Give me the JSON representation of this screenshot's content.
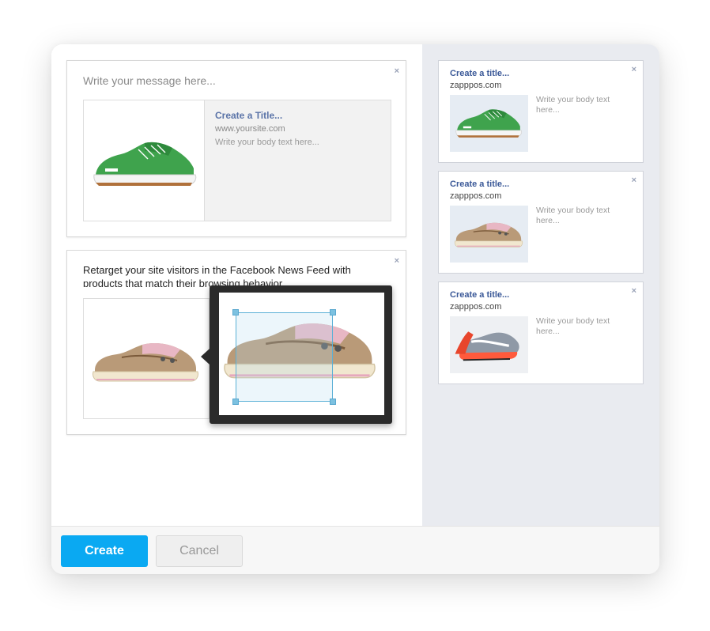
{
  "composer": {
    "message_placeholder": "Write your message here...",
    "preview": {
      "title": "Create a Title...",
      "url": "www.yoursite.com",
      "body": "Write your body text here..."
    },
    "close_glyph": "×"
  },
  "retarget": {
    "description": "Retarget your site visitors in the Facebook News Feed with products that match their browsing behavior.",
    "close_glyph": "×",
    "product_icon": "boat-shoe-image"
  },
  "ads": [
    {
      "title": "Create a title...",
      "site": "zapppos.com",
      "body": "Write your body text here...",
      "image": "green-sneaker-image",
      "close_glyph": "×"
    },
    {
      "title": "Create a title...",
      "site": "zapppos.com",
      "body": "Write your body text here...",
      "image": "boat-shoe-image",
      "close_glyph": "×"
    },
    {
      "title": "Create a title...",
      "site": "zapppos.com",
      "body": "Write your body text here...",
      "image": "running-shoe-image",
      "close_glyph": "×"
    }
  ],
  "footer": {
    "create_label": "Create",
    "cancel_label": "Cancel"
  },
  "colors": {
    "primary_button": "#0aa9f2",
    "link_title": "#3b5998",
    "crop_border": "#5bb0d6",
    "side_panel_bg": "#e9ebf0"
  }
}
